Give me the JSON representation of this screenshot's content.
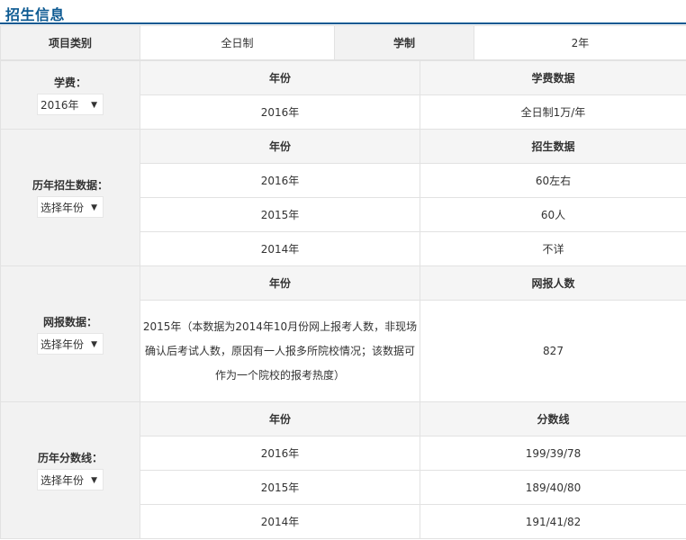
{
  "header": {
    "title": "招生信息"
  },
  "top": {
    "label1": "项目类别",
    "value1": "全日制",
    "label2": "学制",
    "value2": "2年"
  },
  "tuition": {
    "label": "学费：",
    "select": "2016年",
    "col_year": "年份",
    "col_value": "学费数据",
    "rows": [
      {
        "year": "2016年",
        "value": "全日制1万/年"
      }
    ]
  },
  "enrollment": {
    "label": "历年招生数据：",
    "select": "选择年份",
    "col_year": "年份",
    "col_value": "招生数据",
    "rows": [
      {
        "year": "2016年",
        "value": "60左右"
      },
      {
        "year": "2015年",
        "value": "60人"
      },
      {
        "year": "2014年",
        "value": "不详"
      }
    ]
  },
  "online": {
    "label": "网报数据：",
    "select": "选择年份",
    "col_year": "年份",
    "col_value": "网报人数",
    "note_line1": "2015年（本数据为2014年10月份网上报考人数，非现场",
    "note_line2": "确认后考试人数，原因有一人报多所院校情况；该数据可",
    "note_line3": "作为一个院校的报考热度）",
    "value": "827"
  },
  "scores": {
    "label": "历年分数线：",
    "select": "选择年份",
    "col_year": "年份",
    "col_value": "分数线",
    "rows": [
      {
        "year": "2016年",
        "value": "199/39/78"
      },
      {
        "year": "2015年",
        "value": "189/40/80"
      },
      {
        "year": "2014年",
        "value": "191/41/82"
      }
    ]
  },
  "icons": {
    "caret": "▼"
  }
}
